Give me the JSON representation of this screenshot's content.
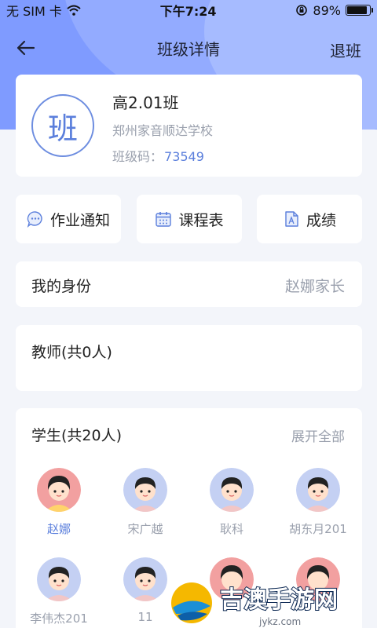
{
  "status_bar": {
    "carrier": "无 SIM 卡",
    "time": "下午7:24",
    "battery_text": "89%",
    "battery_level": 0.89
  },
  "nav": {
    "title": "班级详情",
    "right_action": "退班"
  },
  "class_info": {
    "logo_char": "班",
    "name": "高2.01班",
    "school": "郑州家音顺达学校",
    "code_label": "班级码：",
    "code": "73549"
  },
  "features": [
    {
      "label": "作业通知",
      "icon": "chat-bubble-icon"
    },
    {
      "label": "课程表",
      "icon": "calendar-icon"
    },
    {
      "label": "成绩",
      "icon": "document-icon"
    }
  ],
  "identity": {
    "label": "我的身份",
    "value": "赵娜家长"
  },
  "teachers": {
    "label": "教师(共0人)"
  },
  "students": {
    "label": "学生(共20人)",
    "expand_label": "展开全部",
    "items": [
      {
        "name": "赵娜",
        "avatar": "girl",
        "selected": true
      },
      {
        "name": "宋广越",
        "avatar": "boy",
        "selected": false
      },
      {
        "name": "耿科",
        "avatar": "boy",
        "selected": false
      },
      {
        "name": "胡东月201",
        "avatar": "boy",
        "selected": false
      },
      {
        "name": "李伟杰201",
        "avatar": "boy",
        "selected": false
      },
      {
        "name": "11",
        "avatar": "boy",
        "selected": false
      },
      {
        "name": "",
        "avatar": "girl",
        "selected": false
      },
      {
        "name": "",
        "avatar": "girl",
        "selected": false
      }
    ]
  },
  "watermark": {
    "text": "吉澳手游网",
    "url": "jykz.com"
  },
  "colors": {
    "accent": "#5b7fdc",
    "header_bg": "#7f9bff",
    "page_bg": "#f3f5fa",
    "muted_text": "#9aa0ad"
  }
}
